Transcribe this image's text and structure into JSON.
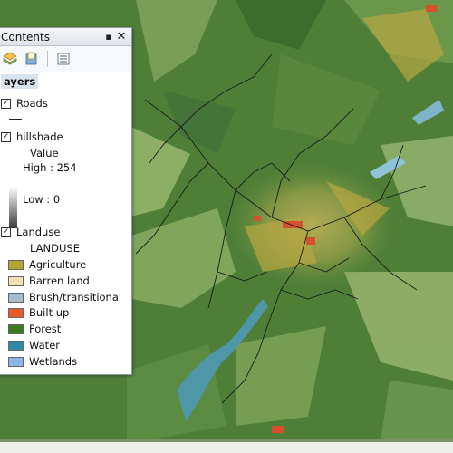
{
  "toc": {
    "title": "Contents",
    "pin_label": "▪",
    "close_label": "✕",
    "layers_label": "ayers",
    "layers": {
      "roads": {
        "label": "Roads",
        "checked": true
      },
      "hillshade": {
        "label": "hillshade",
        "checked": true,
        "value_label": "Value",
        "high_label": "High : 254",
        "low_label": "Low : 0"
      },
      "landuse": {
        "label": "Landuse",
        "checked": true,
        "field_label": "LANDUSE",
        "classes": [
          {
            "label": "Agriculture",
            "color": "#b5a633"
          },
          {
            "label": "Barren land",
            "color": "#f6ddb2"
          },
          {
            "label": "Brush/transitional",
            "color": "#a8bcd0"
          },
          {
            "label": "Built up",
            "color": "#ea5a2a"
          },
          {
            "label": "Forest",
            "color": "#3c7a1f"
          },
          {
            "label": "Water",
            "color": "#2f8aa8"
          },
          {
            "label": "Wetlands",
            "color": "#8cb4e6"
          }
        ]
      }
    },
    "toolbar_icons": [
      "list-by-drawing-order-icon",
      "list-by-source-icon",
      "options-icon"
    ]
  },
  "map": {
    "forest_color": "#4f7f37",
    "agriculture_color": "#b8a743",
    "water_color": "#4f97a8",
    "builtup_color": "#d6502f",
    "road_color": "#1a1a1a"
  }
}
